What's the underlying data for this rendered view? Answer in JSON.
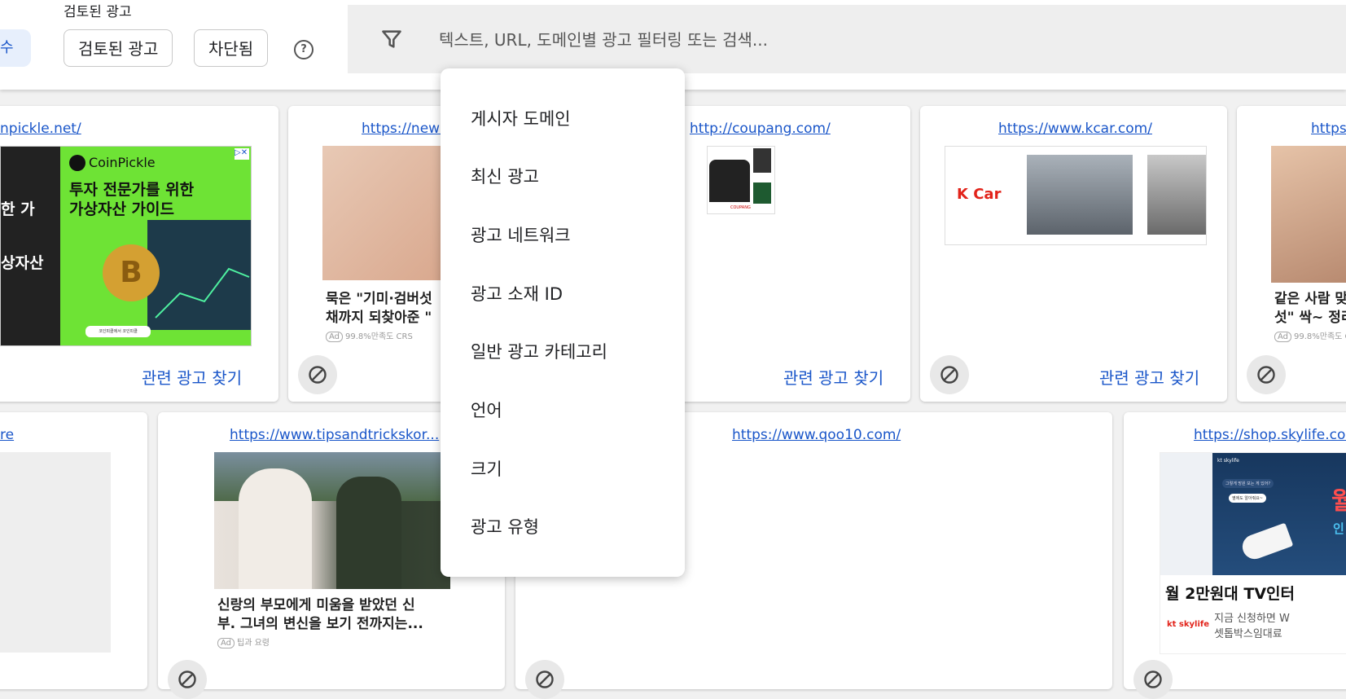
{
  "header": {
    "reviewed_label": "검토된 광고",
    "partial_chip": "수",
    "chips": [
      "검토된 광고",
      "차단됨"
    ],
    "help": "?"
  },
  "search": {
    "placeholder": "텍스트, URL, 도메인별 광고 필터링 또는 검색..."
  },
  "dropdown": {
    "items": [
      "게시자 도메인",
      "최신 광고",
      "광고 네트워크",
      "광고 소재 ID",
      "일반 광고 카테고리",
      "언어",
      "크기",
      "광고 유형"
    ]
  },
  "cards_row1": [
    {
      "url": "npickle.net/",
      "related": "관련 광고 찾기",
      "ad_brand": "CoinPickle",
      "ad_headline_1": "투자 전문가를 위한",
      "ad_headline_2": "가상자산 가이드",
      "ad_side_1": "한 가",
      "ad_side_2": "상자산",
      "ad_small": "코인피클에서 코인피클 Coinpickle.net"
    },
    {
      "url": "https://news",
      "caption_1": "묵은 \"기미·검버섯",
      "caption_2": "채까지 되찾아준 \"",
      "meta": "99.8%만족도 CRS"
    },
    {
      "url": "http://coupang.com/",
      "related": "관련 광고 찾기",
      "ad_small": "COUPANG"
    },
    {
      "url": "https://www.kcar.com/",
      "related": "관련 광고 찾기",
      "ad_brand": "K Car"
    },
    {
      "url": "https:",
      "caption_1": "같은 사람 맞",
      "caption_2": "섯\" 싹~ 정리",
      "meta": "99.8%만족도 C"
    }
  ],
  "cards_row2": [
    {
      "url": "re"
    },
    {
      "url": "https://www.tipsandtrickskor...",
      "caption_1": "신랑의 부모에게 미움을 받았던 신",
      "caption_2": "부. 그녀의 변신을 보기 전까지는...",
      "meta": "팁과 요령"
    },
    {
      "url": "https://www.qoo10.com/"
    },
    {
      "url": "https://shop.skylife.co.k",
      "ad_brand": "kt skylife",
      "ad_headline": "월 2만원대 TV인터",
      "ad_sub_1": "지금 신청하면 W",
      "ad_sub_2": "셋톱박스임대료",
      "ad_small_1": "그렇게 망원 보는 게 있어?",
      "ad_small_2": "옆에도 알아줘요~",
      "ad_promo_1": "월",
      "ad_promo_2": "인"
    }
  ],
  "colors": {
    "link": "#1a56c9",
    "coinpickle_green": "#6ee335",
    "kcar_red": "#e2231a"
  }
}
